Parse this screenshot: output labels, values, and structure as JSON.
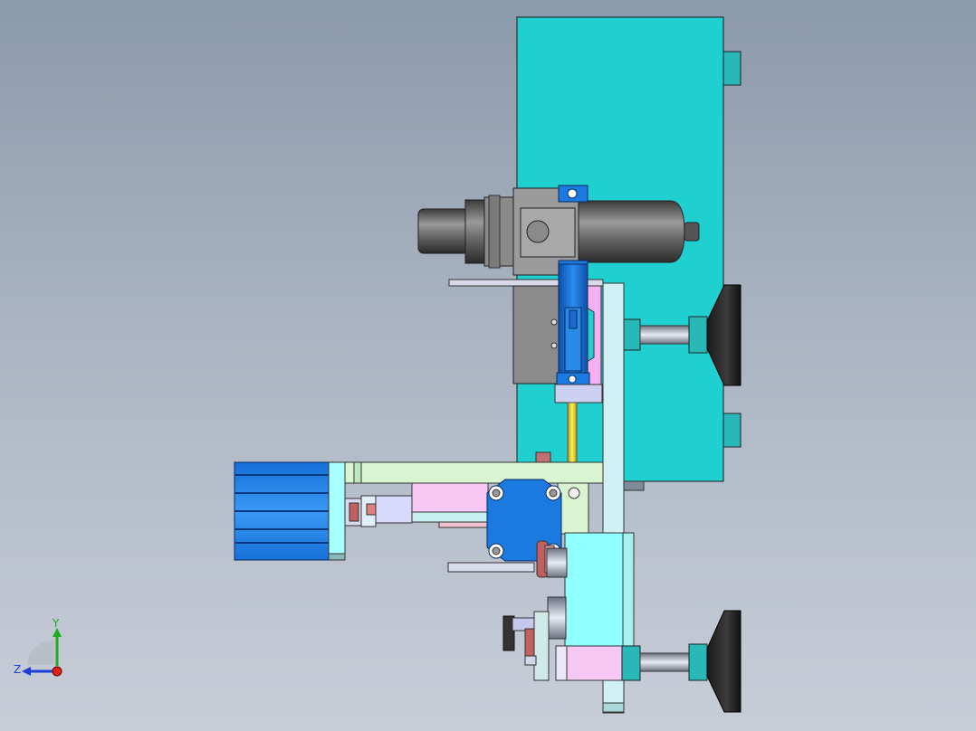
{
  "triad": {
    "y_label": "Y",
    "z_label": "Z",
    "x_color": "#e0201a",
    "y_color": "#18b020",
    "z_color": "#1a3fd8"
  },
  "colors": {
    "background_top": "#8b9aac",
    "background_bottom": "#c8ced8",
    "main_plate": "#20d0d0",
    "cylinder_gray": "#707070",
    "blue_part": "#1a7ae0",
    "pink_part": "#f4c8f0",
    "light_green_part": "#d8f4d0",
    "light_cyan_part": "#a8ffff",
    "dark_pad": "#2a2a2a",
    "yellow_rod": "#e8d010"
  }
}
